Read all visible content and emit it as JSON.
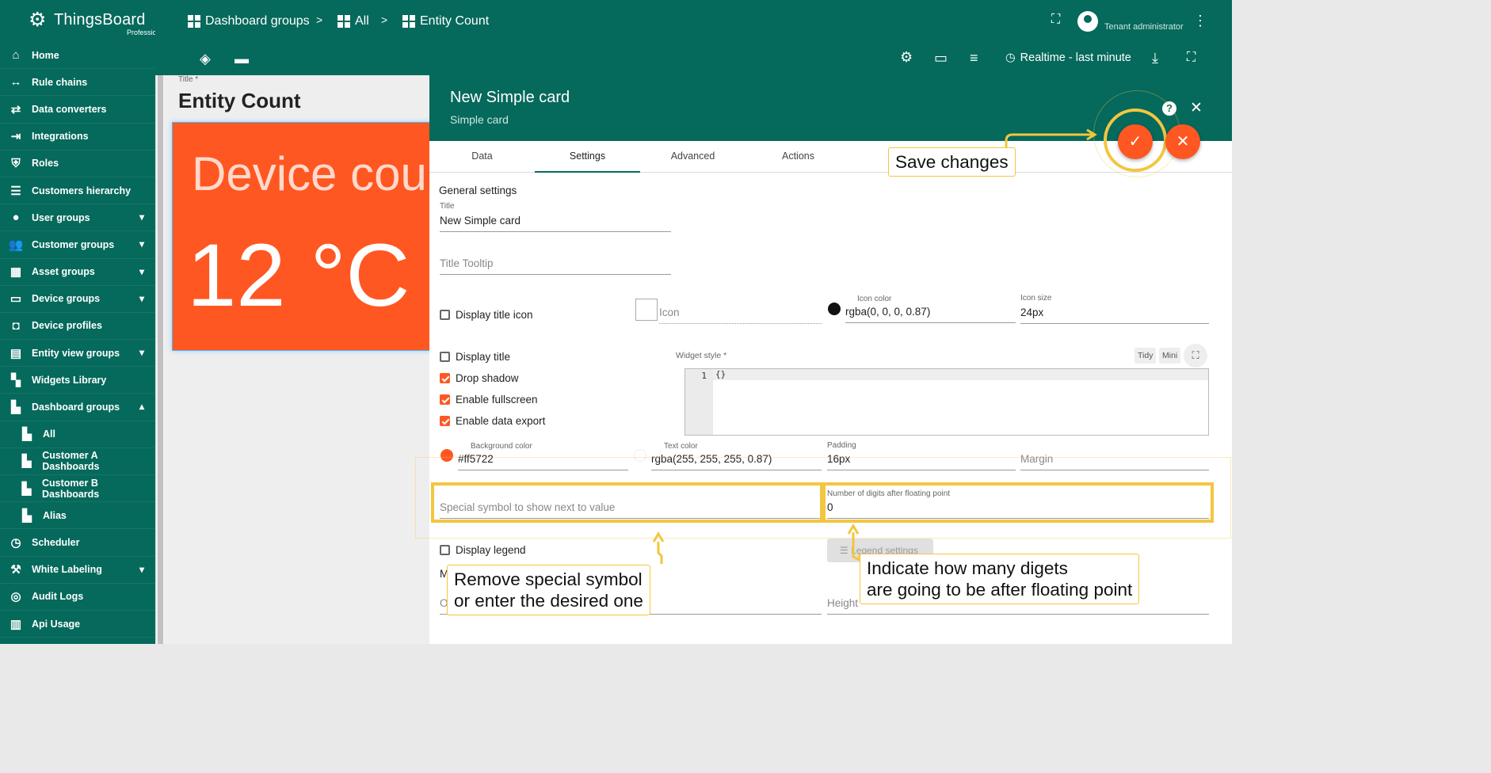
{
  "app": {
    "logo_name": "ThingsBoard",
    "logo_edition": "Professional"
  },
  "breadcrumb": [
    {
      "label": "Dashboard groups"
    },
    {
      "label": "All"
    },
    {
      "label": "Entity Count"
    }
  ],
  "breadcrumb_separator": ">",
  "user": {
    "role": "Tenant administrator"
  },
  "toolbar": {
    "timewindow": "Realtime - last minute"
  },
  "sidebar": {
    "items": [
      {
        "label": "Home",
        "icon": "home-icon"
      },
      {
        "label": "Rule chains",
        "icon": "rule-chain-icon"
      },
      {
        "label": "Data converters",
        "icon": "converter-icon"
      },
      {
        "label": "Integrations",
        "icon": "integration-icon"
      },
      {
        "label": "Roles",
        "icon": "shield-icon"
      },
      {
        "label": "Customers hierarchy",
        "icon": "hierarchy-icon"
      },
      {
        "label": "User groups",
        "icon": "account-icon"
      },
      {
        "label": "Customer groups",
        "icon": "people-icon"
      },
      {
        "label": "Asset groups",
        "icon": "domain-icon"
      },
      {
        "label": "Device groups",
        "icon": "devices-icon"
      },
      {
        "label": "Device profiles",
        "icon": "device-profile-icon"
      },
      {
        "label": "Entity view groups",
        "icon": "view-quilt-icon"
      },
      {
        "label": "Widgets Library",
        "icon": "widgets-icon"
      },
      {
        "label": "Dashboard groups",
        "icon": "dashboard-icon"
      },
      {
        "label": "All",
        "icon": "dashboard-icon"
      },
      {
        "label": "Customer A Dashboards",
        "icon": "dashboard-icon"
      },
      {
        "label": "Customer B Dashboards",
        "icon": "dashboard-icon"
      },
      {
        "label": "Alias",
        "icon": "dashboard-icon"
      },
      {
        "label": "Scheduler",
        "icon": "schedule-icon"
      },
      {
        "label": "White Labeling",
        "icon": "format-paint-icon"
      },
      {
        "label": "Audit Logs",
        "icon": "track-changes-icon"
      },
      {
        "label": "Api Usage",
        "icon": "insert-chart-icon"
      }
    ]
  },
  "dashboard": {
    "title_label": "Title *",
    "title_value": "Entity Count",
    "widget_heading": "Device cou",
    "widget_value": "12 °C"
  },
  "panel": {
    "title": "New Simple card",
    "subtitle": "Simple card",
    "tabs": [
      "Data",
      "Settings",
      "Advanced",
      "Actions"
    ],
    "active_tab": "Settings",
    "general_settings": "General settings",
    "title_label": "Title",
    "title_value": "New Simple card",
    "title_tooltip_placeholder": "Title Tooltip",
    "display_title_icon": "Display title icon",
    "icon_placeholder": "Icon",
    "icon_color_label": "Icon color",
    "icon_color_value": "rgba(0, 0, 0, 0.87)",
    "icon_size_label": "Icon size",
    "icon_size_value": "24px",
    "display_title": "Display title",
    "drop_shadow": "Drop shadow",
    "enable_fullscreen": "Enable fullscreen",
    "enable_data_export": "Enable data export",
    "widget_style_label": "Widget style *",
    "tidy_label": "Tidy",
    "mini_label": "Mini",
    "code_line_number": "1",
    "code_content": "{}",
    "bg_color_label": "Background color",
    "bg_color_value": "#ff5722",
    "text_color_label": "Text color",
    "text_color_value": "rgba(255, 255, 255, 0.87)",
    "padding_label": "Padding",
    "padding_value": "16px",
    "margin_placeholder": "Margin",
    "special_symbol_placeholder": "Special symbol to show next to value",
    "decimals_label": "Number of digits after floating point",
    "decimals_value": "0",
    "display_legend": "Display legend",
    "legend_settings": "Legend settings",
    "mobile_stub": "M",
    "order_stub": "O",
    "height_placeholder": "Height"
  },
  "annotations": {
    "save": "Save changes",
    "symbol_line1": "Remove special symbol",
    "symbol_line2": "or enter the desired one",
    "digits_line1": "Indicate how many digets",
    "digits_line2": "are going to be after floating point"
  },
  "colors": {
    "brand": "#05695c",
    "accent": "#ff5722",
    "highlight": "#f3c63f"
  }
}
